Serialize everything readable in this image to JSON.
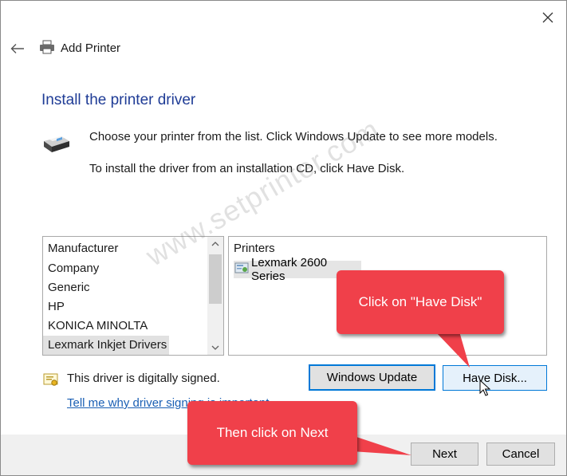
{
  "window": {
    "title": "Add Printer",
    "close_icon": "close-icon",
    "back_icon": "back-arrow-icon"
  },
  "heading": "Install the printer driver",
  "instructions": {
    "line1": "Choose your printer from the list. Click Windows Update to see more models.",
    "line2": "To install the driver from an installation CD, click Have Disk."
  },
  "manufacturer_list": {
    "header": "Manufacturer",
    "items": [
      "Company",
      "Generic",
      "HP",
      "KONICA MINOLTA",
      "Lexmark Inkjet Drivers"
    ],
    "selected": "Lexmark Inkjet Drivers"
  },
  "printers_list": {
    "header": "Printers",
    "items": [
      "Lexmark 2600 Series"
    ],
    "selected": "Lexmark 2600 Series"
  },
  "signature": {
    "text": "This driver is digitally signed.",
    "link": "Tell me why driver signing is important"
  },
  "buttons": {
    "windows_update": "Windows Update",
    "have_disk": "Have Disk...",
    "next": "Next",
    "cancel": "Cancel"
  },
  "annotations": {
    "callout_have_disk": "Click on \"Have Disk\"",
    "callout_next": "Then click on Next",
    "watermark": "www.setprinter.com",
    "callout_color": "#f0404a"
  },
  "colors": {
    "heading": "#1f3c96",
    "link": "#1a5fb4",
    "focus_border": "#0078d7",
    "footer_bg": "#f0f0f0"
  }
}
